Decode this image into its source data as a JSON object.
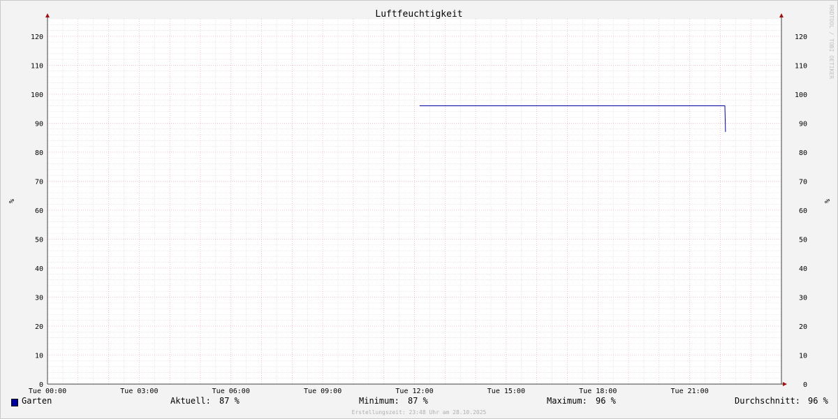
{
  "chart_data": {
    "type": "line",
    "title": "Luftfeuchtigkeit",
    "ylabel": "%",
    "ylim": [
      0,
      126
    ],
    "yticks": [
      0,
      10,
      20,
      30,
      40,
      50,
      60,
      70,
      80,
      90,
      100,
      110,
      120
    ],
    "xlim_hours": [
      0,
      24
    ],
    "xticks": [
      {
        "hour": 0,
        "label": "Tue 00:00"
      },
      {
        "hour": 3,
        "label": "Tue 03:00"
      },
      {
        "hour": 6,
        "label": "Tue 06:00"
      },
      {
        "hour": 9,
        "label": "Tue 09:00"
      },
      {
        "hour": 12,
        "label": "Tue 12:00"
      },
      {
        "hour": 15,
        "label": "Tue 15:00"
      },
      {
        "hour": 18,
        "label": "Tue 18:00"
      },
      {
        "hour": 21,
        "label": "Tue 21:00"
      }
    ],
    "grid": true,
    "series": [
      {
        "name": "Garten",
        "color": "#0000a0",
        "points": [
          [
            12.17,
            96
          ],
          [
            22.15,
            96
          ],
          [
            22.17,
            87
          ]
        ]
      }
    ]
  },
  "legend": {
    "series_name": "Garten",
    "current_label": "Aktuell:",
    "current_value": "87 %",
    "min_label": "Minimum:",
    "min_value": "87 %",
    "max_label": "Maximum:",
    "max_value": "96 %",
    "avg_label": "Durchschnitt:",
    "avg_value": "96 %"
  },
  "footer": "Erstellungszeit: 23:48 Uhr am 28.10.2025",
  "watermark": "RRDTOOL / TOBI OETIKER"
}
